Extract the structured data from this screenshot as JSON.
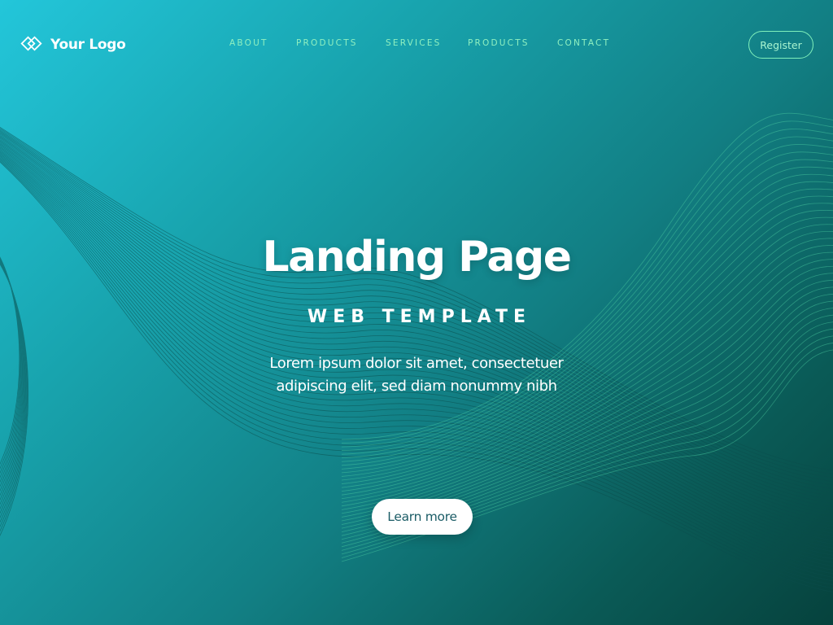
{
  "brand": {
    "logo_text": "Your Logo",
    "logo_icon": "diamond-logo-icon"
  },
  "nav": {
    "items": [
      {
        "label": "ABOUT"
      },
      {
        "label": "PRODUCTS"
      },
      {
        "label": "SERVICES"
      },
      {
        "label": "PRODUCTS"
      },
      {
        "label": "CONTACT"
      }
    ],
    "register_label": "Register"
  },
  "hero": {
    "title": "Landing Page",
    "subtitle": "WEB TEMPLATE",
    "body_line1": "Lorem ipsum dolor sit amet, consectetuer",
    "body_line2": "adipiscing elit, sed diam nonummy nibh",
    "cta_label": "Learn more"
  },
  "colors": {
    "gradient_start": "#23c6da",
    "gradient_end": "#06423d",
    "nav_text": "#8ff0c0",
    "register_border": "#7ff0bb",
    "cta_text": "#1b5c66"
  }
}
